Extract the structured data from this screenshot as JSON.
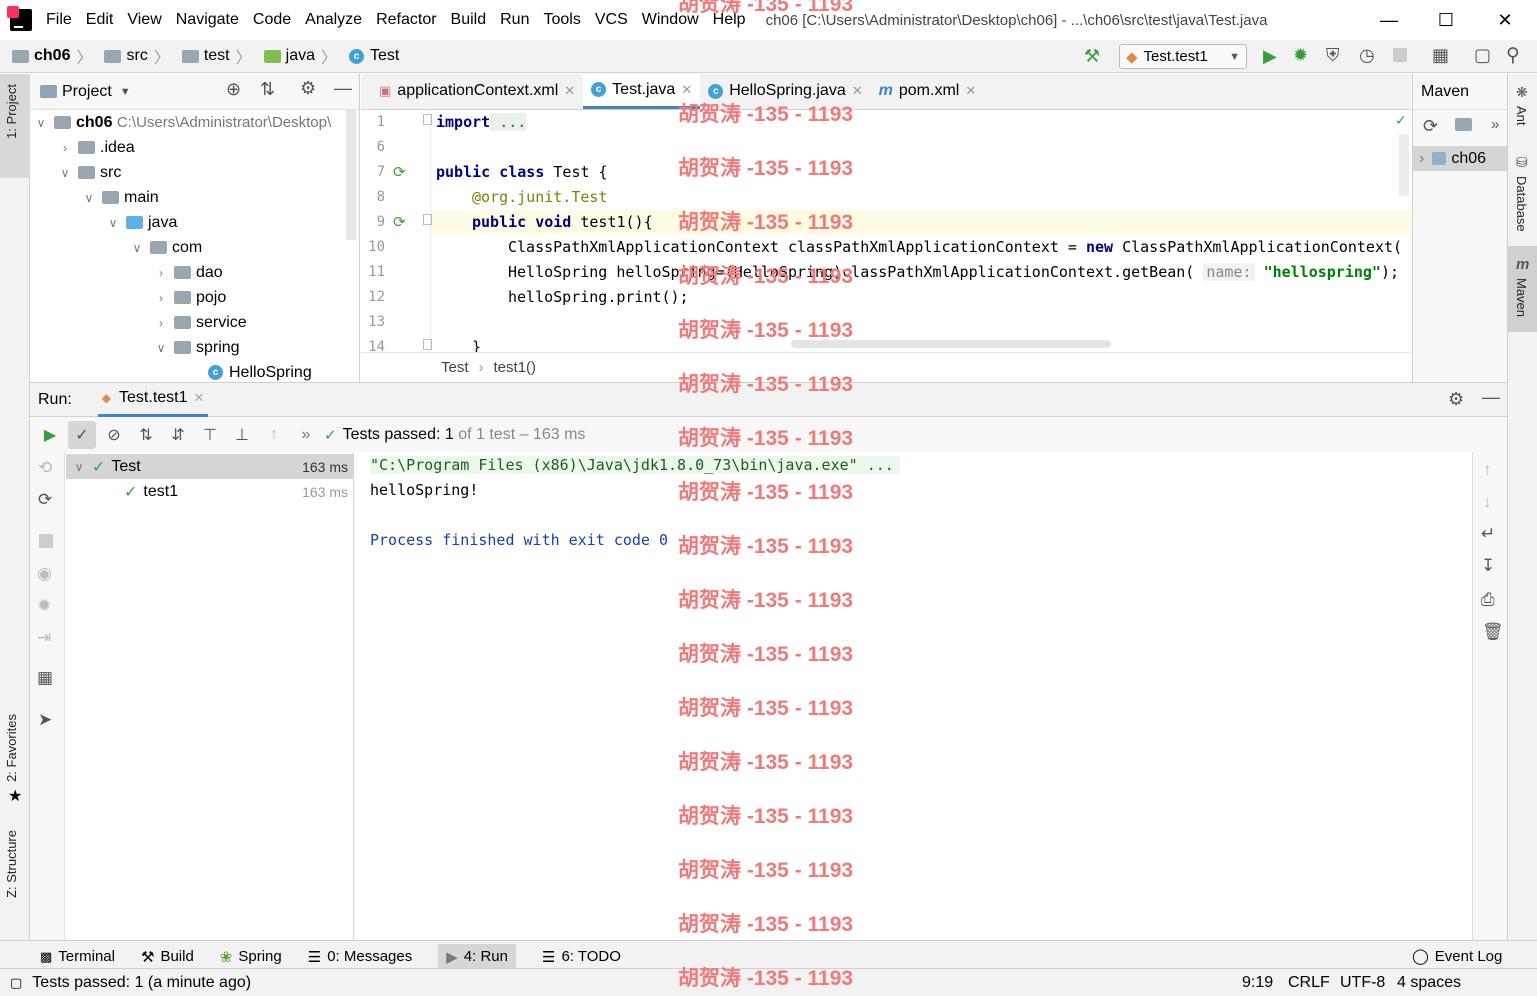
{
  "menu": [
    "File",
    "Edit",
    "View",
    "Navigate",
    "Code",
    "Analyze",
    "Refactor",
    "Build",
    "Run",
    "Tools",
    "VCS",
    "Window",
    "Help"
  ],
  "window_title": "ch06 [C:\\Users\\Administrator\\Desktop\\ch06] - ...\\ch06\\src\\test\\java\\Test.java",
  "breadcrumb": [
    "ch06",
    "src",
    "test",
    "java",
    "Test"
  ],
  "run_config": "Test.test1",
  "watermark": "胡贺涛 -135 - 1193",
  "project": {
    "title": "Project",
    "root_name": "ch06",
    "root_path": "C:\\Users\\Administrator\\Desktop\\",
    "items": [
      ".idea",
      "src",
      "main",
      "java",
      "com",
      "dao",
      "pojo",
      "service",
      "spring",
      "HelloSpring"
    ]
  },
  "editor": {
    "tabs": [
      "applicationContext.xml",
      "Test.java",
      "HelloSpring.java",
      "pom.xml"
    ],
    "line_numbers": [
      "1",
      "6",
      "7",
      "8",
      "9",
      "10",
      "11",
      "12",
      "13",
      "14"
    ],
    "code": {
      "l1_kw": "import",
      "l1_rest": " ...",
      "l7_a": "public class",
      "l7_b": " Test {",
      "l8_a": "@org.junit.",
      "l8_b": "Test",
      "l9_a": "public void",
      "l9_b": " test1(){",
      "l10_a": "ClassPathXmlApplicationContext classPathXmlApplicationContext = ",
      "l10_kw": "new",
      "l10_b": " ClassPathXmlApplicationContext(",
      "l11_a": "HelloSpring helloSpring=(HelloSpring)classPathXmlApplicationContext.getBean( ",
      "l11_hint": "name:",
      "l11_str": "\"hellospring\"",
      "l11_end": ");",
      "l12": "helloSpring.print();",
      "l14": "}"
    },
    "breadcrumb": [
      "Test",
      "test1()"
    ]
  },
  "maven": {
    "title": "Maven",
    "project": "ch06"
  },
  "right_strip": [
    "Ant",
    "Database",
    "Maven"
  ],
  "left_strip": [
    "1: Project",
    "2: Favorites",
    "Z: Structure"
  ],
  "run": {
    "label": "Run:",
    "tab": "Test.test1",
    "status_prefix": "Tests passed: ",
    "status_count": "1",
    "status_suffix": " of 1 test – 163 ms",
    "tree": [
      {
        "name": "Test",
        "time": "163 ms"
      },
      {
        "name": "test1",
        "time": "163 ms"
      }
    ],
    "console": [
      "\"C:\\Program Files (x86)\\Java\\jdk1.8.0_73\\bin\\java.exe\" ...",
      "helloSpring!",
      "",
      "Process finished with exit code 0"
    ]
  },
  "bottom_tabs": [
    "Terminal",
    "Build",
    "Spring",
    "0: Messages",
    "4: Run",
    "6: TODO"
  ],
  "event_log": "Event Log",
  "status_bar": {
    "message": "Tests passed: 1 (a minute ago)",
    "position": "9:19",
    "line_sep": "CRLF",
    "encoding": "UTF-8",
    "indent": "4 spaces"
  },
  "colors": {
    "accent": "#4083c9",
    "pass": "#389e3d",
    "watermark": "#ef7a7a"
  }
}
